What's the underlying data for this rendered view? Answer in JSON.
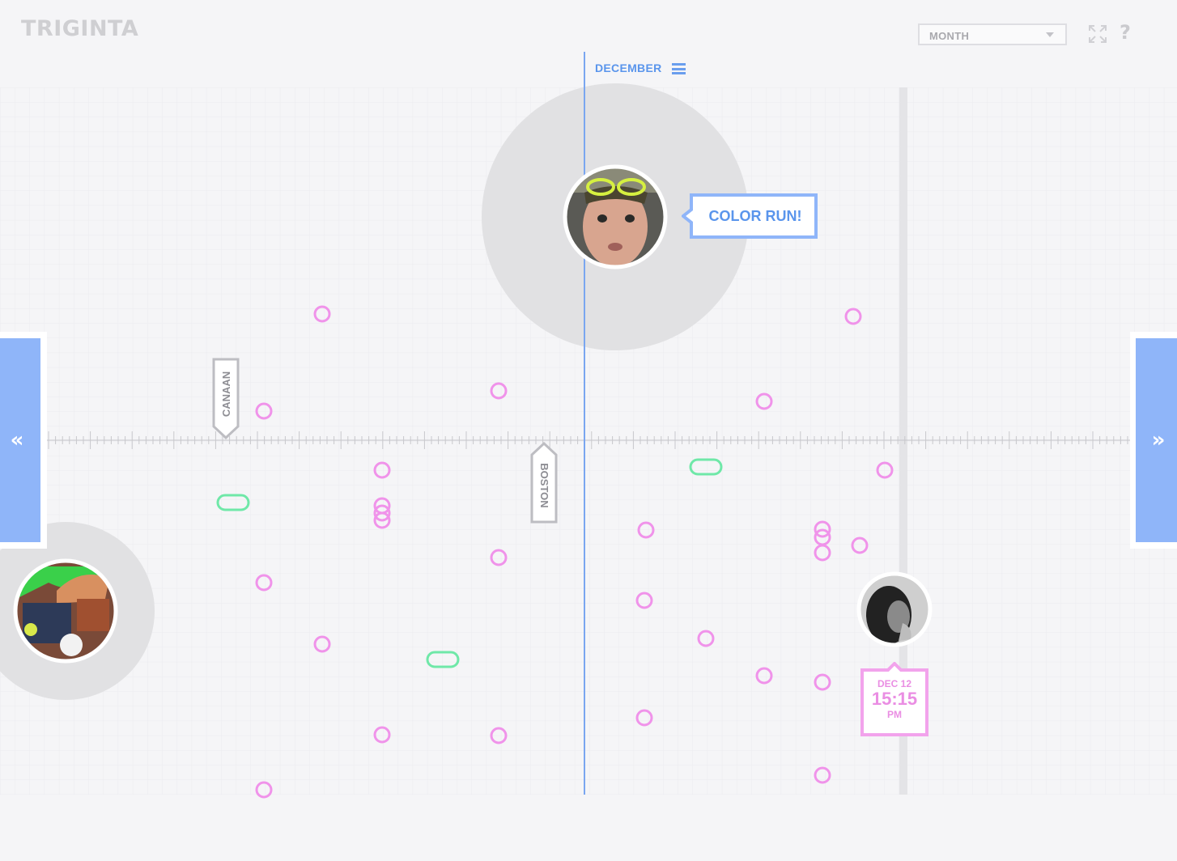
{
  "app": {
    "title": "TRIGINTA"
  },
  "toolbar": {
    "view_select": {
      "value": "MONTH"
    },
    "fullscreen_icon": "expand-icon",
    "help_label": "?"
  },
  "timeline": {
    "month_label": "DECEMBER",
    "menu_icon": "hamburger-menu-icon",
    "nav_prev_label": "«",
    "nav_next_label": "»",
    "location_markers": [
      {
        "label": "CANAAN"
      },
      {
        "label": "BOSTON"
      }
    ],
    "featured_event": {
      "label": "COLOR RUN!"
    },
    "timestamp": {
      "date": "DEC 12",
      "time": "15:15",
      "period": "PM"
    },
    "colors": {
      "accent": "#8fb5f9",
      "accent_text": "#5a95ec",
      "pink": "#ea8ee3",
      "green": "#6fe8a8",
      "grid": "#e8e8ec"
    }
  }
}
